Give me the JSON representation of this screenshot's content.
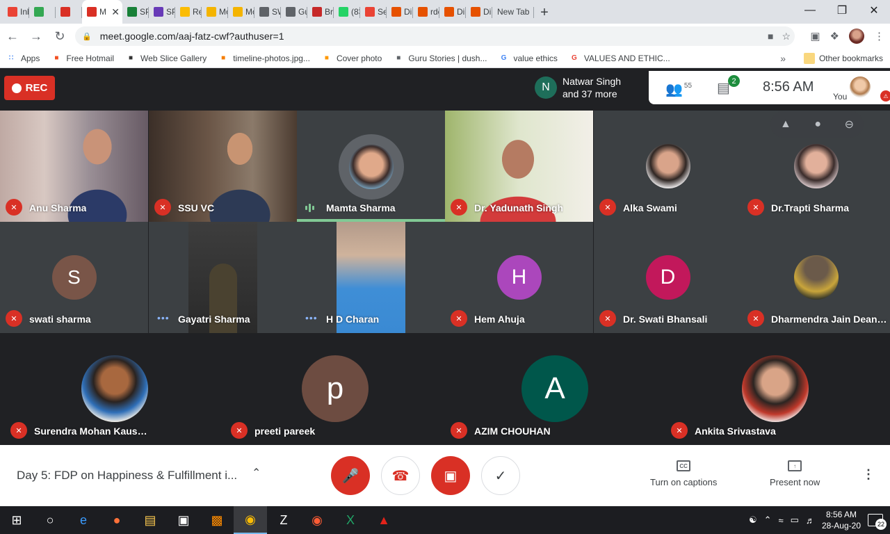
{
  "tabs": [
    {
      "label": "Inb",
      "icon": "gmail-icon",
      "color": "#ea4335"
    },
    {
      "label": "",
      "icon": "chat-icon",
      "color": "#34a853"
    },
    {
      "label": "",
      "icon": "record-icon",
      "color": "#d93025"
    },
    {
      "label": "M",
      "icon": "meet-icon",
      "color": "#d93025",
      "active": true
    },
    {
      "label": "SPI",
      "icon": "sheets-icon",
      "color": "#188038"
    },
    {
      "label": "SPI",
      "icon": "forms-icon",
      "color": "#673ab7"
    },
    {
      "label": "Rec",
      "icon": "drive-icon",
      "color": "#fbbc04"
    },
    {
      "label": "Mo",
      "icon": "slides-icon",
      "color": "#f4b400"
    },
    {
      "label": "Mo",
      "icon": "slides-icon",
      "color": "#f4b400"
    },
    {
      "label": "SW",
      "icon": "globe-icon",
      "color": "#5f6368"
    },
    {
      "label": "Gui",
      "icon": "globe-icon",
      "color": "#5f6368"
    },
    {
      "label": "Bria",
      "icon": "apple-icon",
      "color": "#c62828"
    },
    {
      "label": "(83",
      "icon": "whatsapp-icon",
      "color": "#25d366"
    },
    {
      "label": "Sea",
      "icon": "gmail-icon",
      "color": "#ea4335"
    },
    {
      "label": "Dir",
      "icon": "dir-icon",
      "color": "#e65100"
    },
    {
      "label": "rdc",
      "icon": "dir-icon",
      "color": "#e65100"
    },
    {
      "label": "Dir",
      "icon": "dir-icon",
      "color": "#e65100"
    },
    {
      "label": "Dir",
      "icon": "dir-icon",
      "color": "#e65100"
    },
    {
      "label": "New Tab",
      "icon": "",
      "color": ""
    }
  ],
  "address": {
    "url": "meet.google.com/aaj-fatz-cwf?authuser=1"
  },
  "bookmarks": [
    {
      "label": "Apps",
      "icon": "apps-icon",
      "color": "#4285f4"
    },
    {
      "label": "Free Hotmail",
      "icon": "windows-icon",
      "color": "#f25022"
    },
    {
      "label": "Web Slice Gallery",
      "icon": "slice-icon",
      "color": "#333333"
    },
    {
      "label": "timeline-photos.jpg...",
      "icon": "blogger-icon",
      "color": "#f57d00"
    },
    {
      "label": "Cover photo",
      "icon": "star-icon",
      "color": "#ff9800"
    },
    {
      "label": "Guru Stories | dush...",
      "icon": "globe-icon",
      "color": "#5f6368"
    },
    {
      "label": "value ethics",
      "icon": "google-icon",
      "color": "#4285f4"
    },
    {
      "label": "VALUES AND ETHIC...",
      "icon": "google-icon",
      "color": "#ea4335"
    }
  ],
  "other_bookmarks": "Other bookmarks",
  "meet": {
    "rec_label": "REC",
    "speaker_initial": "N",
    "speaker_line1": "Natwar Singh",
    "speaker_line2": "and 37 more",
    "participants_count": "55",
    "chat_badge": "2",
    "clock": "8:56  AM",
    "you_label": "You"
  },
  "participants_row1": [
    {
      "name": "Anu Sharma",
      "status": "muted"
    },
    {
      "name": "SSU VC",
      "status": "muted"
    },
    {
      "name": "Mamta Sharma",
      "status": "speaking"
    },
    {
      "name": "Dr. Yadunath Singh",
      "status": "muted"
    },
    {
      "name": "Alka Swami",
      "status": "muted"
    },
    {
      "name": "Dr.Trapti Sharma",
      "status": "muted"
    }
  ],
  "participants_row2": [
    {
      "name": "swati sharma",
      "status": "muted",
      "initial": "S",
      "avatar_color": "#795548"
    },
    {
      "name": "Gayatri Sharma",
      "status": "dots"
    },
    {
      "name": "H D Charan",
      "status": "dots"
    },
    {
      "name": "Hem Ahuja",
      "status": "muted",
      "initial": "H",
      "avatar_color": "#ab47bc"
    },
    {
      "name": "Dr. Swati Bhansali",
      "status": "muted",
      "initial": "D",
      "avatar_color": "#c2185b"
    },
    {
      "name": "Dharmendra Jain Dean M...",
      "status": "muted"
    }
  ],
  "participants_row3": [
    {
      "name": "Surendra Mohan Kaushik",
      "status": "muted"
    },
    {
      "name": "preeti pareek",
      "status": "muted",
      "initial": "p",
      "avatar_color": "#6d4c41"
    },
    {
      "name": "AZIM CHOUHAN",
      "status": "muted",
      "initial": "A",
      "avatar_color": "#00574b"
    },
    {
      "name": "Ankita Srivastava",
      "status": "muted"
    }
  ],
  "bottom": {
    "meeting_title": "Day 5: FDP on Happiness & Fulfillment i...",
    "captions_label": "Turn on captions",
    "captions_icon": "CC",
    "present_label": "Present now"
  },
  "taskbar": {
    "time": "8:56 AM",
    "date": "28-Aug-20",
    "notifications": "22"
  }
}
